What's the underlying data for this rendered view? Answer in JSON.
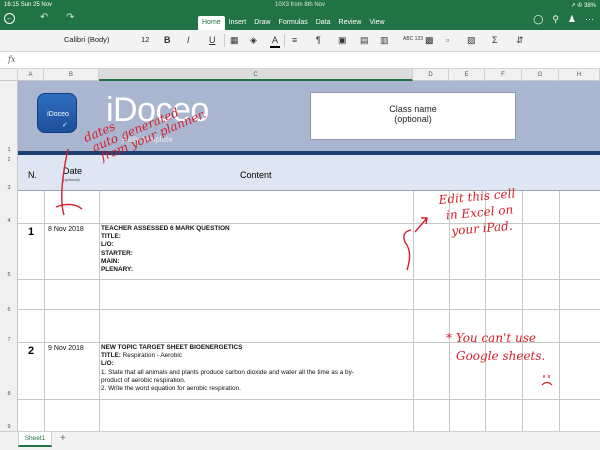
{
  "status": {
    "time": "16:15",
    "day": "Sun 25 Nov",
    "document": "10X3 from 8th Nov",
    "battery": "38%"
  },
  "ribbon": {
    "tabs": [
      "Home",
      "Insert",
      "Draw",
      "Formulas",
      "Data",
      "Review",
      "View"
    ],
    "active_tab": "Home",
    "font_name": "Calibri (Body)",
    "font_size": "12",
    "bold": "B",
    "italic": "I",
    "underline": "U",
    "wrap_text": "ABC 123"
  },
  "formula_bar": {
    "fx": "fx"
  },
  "columns": [
    "A",
    "B",
    "C",
    "D",
    "E",
    "F",
    "G",
    "H"
  ],
  "rows": [
    "1",
    "2",
    "3",
    "4",
    "5",
    "6",
    "7",
    "8",
    "9"
  ],
  "banner": {
    "logo_text": "iDoceo",
    "brand": "iDoceo",
    "subtitle": "Daily template",
    "class_name": "Class name",
    "class_optional": "(optional)"
  },
  "header_row": {
    "number": "N.",
    "date": "Date",
    "date_note": "(optional)",
    "content": "Content"
  },
  "entries": [
    {
      "number": "1",
      "date": "8 Nov 2018",
      "title": "TEACHER ASSESSED 6 MARK QUESTION",
      "lines": [
        "TITLE:",
        "L/O:",
        "STARTER:",
        "MAIN:",
        "PLENARY:"
      ]
    },
    {
      "number": "2",
      "date": "9 Nov 2018",
      "title": "NEW TOPIC TARGET SHEET BIOENERGETICS",
      "title_label": "TITLE:",
      "title_value": "Respiration - Aerobic",
      "lo_label": "L/O:",
      "lines": [
        "1. State that all animals and plants produce carbon dioxide and water all the time as a by-",
        "product of aerobic respiration.",
        "2. Write the word equation for aerobic respiration."
      ]
    }
  ],
  "annotations": {
    "dates": [
      "dates",
      "auto generated",
      "from your planner."
    ],
    "edit": [
      "Edit this cell",
      "in Excel on",
      "your iPad."
    ],
    "google": [
      "* You can't use",
      "Google sheets."
    ]
  },
  "sheet_tabs": [
    "Sheet1"
  ],
  "add_sheet": "+",
  "colors": {
    "excel_green": "#217346",
    "banner": "#aab6cf",
    "ink": "#d2202a"
  }
}
